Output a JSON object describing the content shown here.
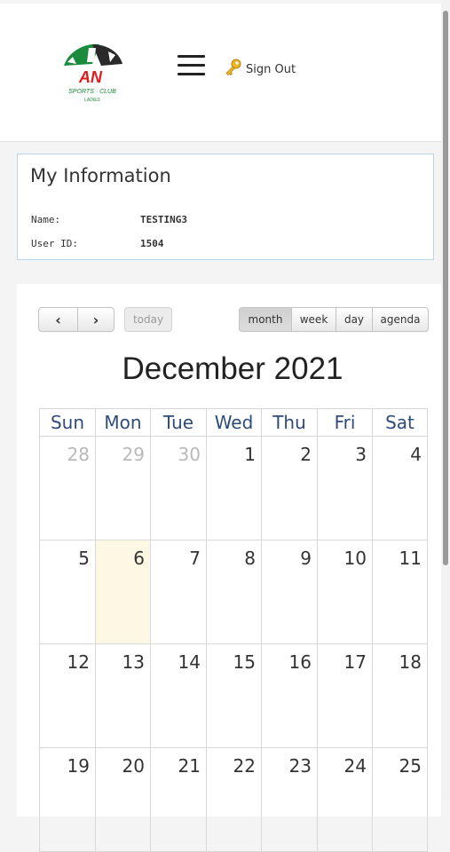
{
  "header": {
    "logo_text": "AN",
    "logo_subtext": "SPORTS · CLUB",
    "logo_caption": "LADIES",
    "signout_label": "Sign Out"
  },
  "info": {
    "title": "My Information",
    "name_label": "Name:",
    "name_value": "TESTING3",
    "userid_label": "User ID:",
    "userid_value": "1504"
  },
  "calendar": {
    "prev_icon": "‹",
    "next_icon": "›",
    "today_label": "today",
    "views": {
      "month": "month",
      "week": "week",
      "day": "day",
      "agenda": "agenda"
    },
    "title": "December 2021",
    "days_of_week": [
      "Sun",
      "Mon",
      "Tue",
      "Wed",
      "Thu",
      "Fri",
      "Sat"
    ],
    "weeks": [
      [
        "28",
        "29",
        "30",
        "1",
        "2",
        "3",
        "4"
      ],
      [
        "5",
        "6",
        "7",
        "8",
        "9",
        "10",
        "11"
      ],
      [
        "12",
        "13",
        "14",
        "15",
        "16",
        "17",
        "18"
      ],
      [
        "19",
        "20",
        "21",
        "22",
        "23",
        "24",
        "25"
      ]
    ],
    "other_month_days": [
      "28",
      "29",
      "30"
    ],
    "today_date": "6",
    "colors": {
      "header_text": "#2f4b7a",
      "today_highlight": "#fcf8e3",
      "other_month_text": "#b9b9b9"
    }
  }
}
